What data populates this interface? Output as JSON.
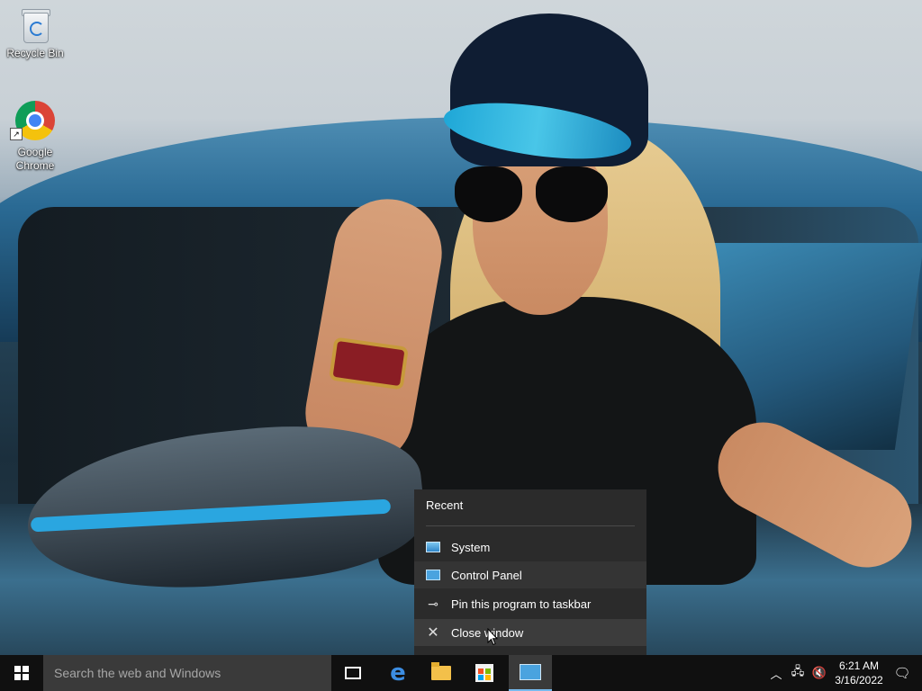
{
  "desktop": {
    "icons": [
      {
        "label": "Recycle Bin",
        "icon": "recycle-bin-icon"
      },
      {
        "label": "Google Chrome",
        "icon": "chrome-icon"
      }
    ]
  },
  "jumplist": {
    "header": "Recent",
    "items": [
      {
        "label": "System",
        "icon": "system-icon"
      },
      {
        "label": "Control Panel",
        "icon": "control-panel-icon"
      }
    ],
    "tasks": [
      {
        "label": "Pin this program to taskbar",
        "icon": "pin-icon"
      },
      {
        "label": "Close window",
        "icon": "close-icon"
      }
    ]
  },
  "taskbar": {
    "search_placeholder": "Search the web and Windows",
    "apps": [
      {
        "name": "Task View",
        "icon": "task-view-icon"
      },
      {
        "name": "Microsoft Edge",
        "icon": "edge-icon"
      },
      {
        "name": "File Explorer",
        "icon": "folder-icon"
      },
      {
        "name": "Store",
        "icon": "store-icon"
      },
      {
        "name": "Control Panel",
        "icon": "control-panel-icon",
        "active": true
      }
    ],
    "tray": {
      "time": "6:21 AM",
      "date": "3/16/2022",
      "icons": [
        "chevron-up-icon",
        "network-icon",
        "volume-muted-icon",
        "notification-icon"
      ]
    }
  },
  "colors": {
    "taskbar_bg": "#101010",
    "search_bg": "#3a3a3a",
    "jumplist_bg": "#2b2b2b",
    "accent": "#76b9ed"
  }
}
